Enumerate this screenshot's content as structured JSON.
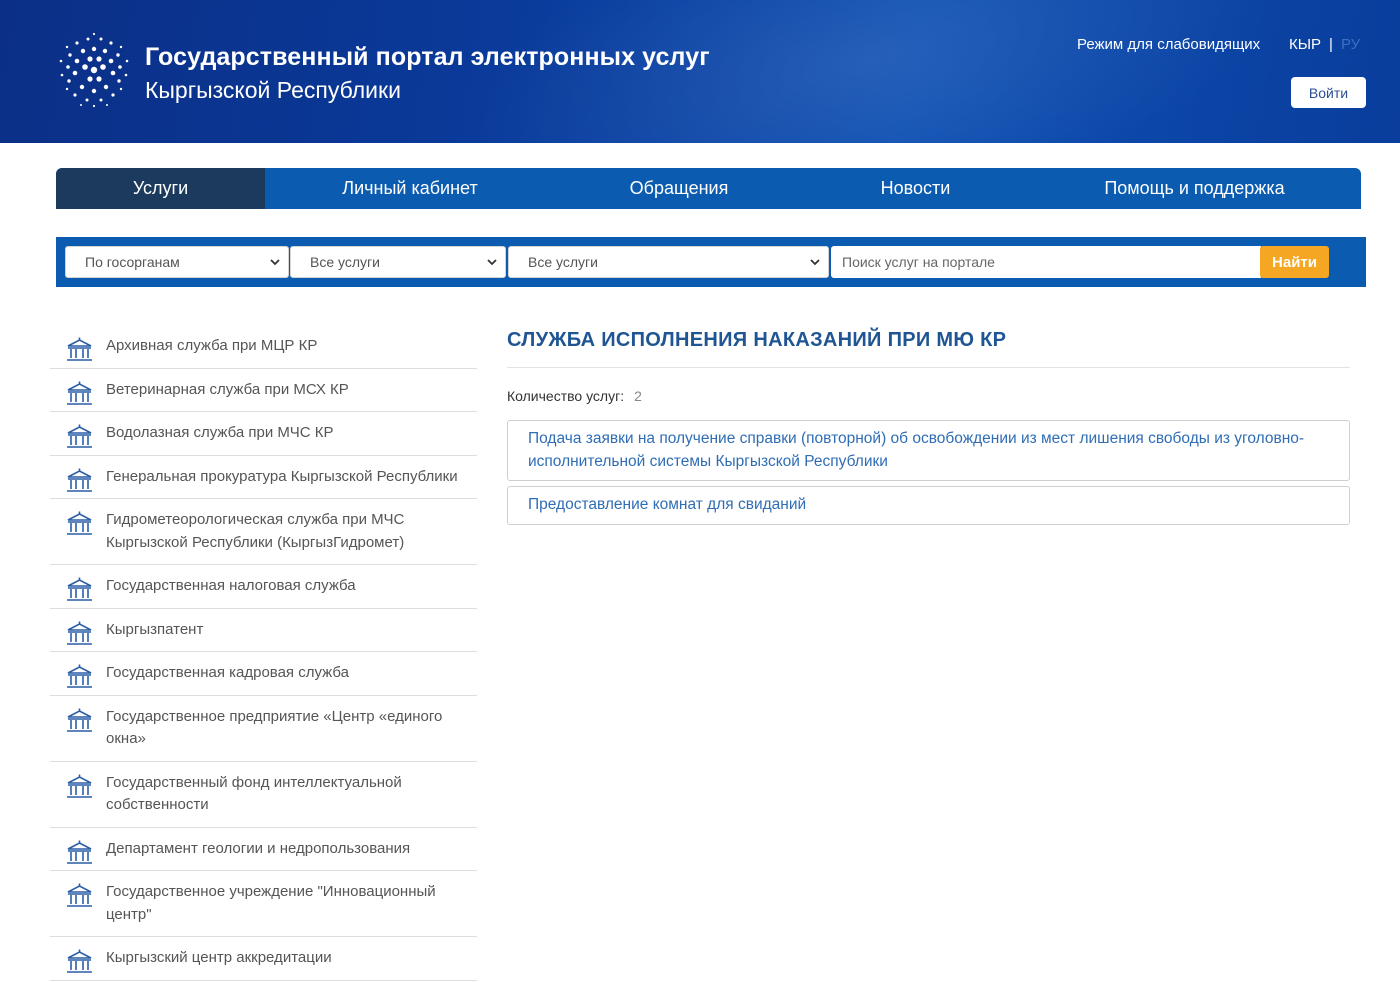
{
  "header": {
    "title_main": "Государственный портал электронных услуг",
    "title_sub": "Кыргызской Республики",
    "accessibility_label": "Режим для слабовидящих",
    "lang_ky": "КЫР",
    "lang_sep": "|",
    "lang_ru": "РУ",
    "login_label": "Войти"
  },
  "nav": {
    "items": [
      {
        "label": "Услуги"
      },
      {
        "label": "Личный кабинет"
      },
      {
        "label": "Обращения"
      },
      {
        "label": "Новости"
      },
      {
        "label": "Помощь и поддержка"
      }
    ]
  },
  "search": {
    "filter_agency": "По госорганам",
    "filter_services_1": "Все услуги",
    "filter_services_2": "Все услуги",
    "placeholder": "Поиск услуг на портале",
    "button_label": "Найти"
  },
  "sidebar": {
    "agencies": [
      "Архивная служба при МЦР КР",
      "Ветеринарная служба при МСХ КР",
      "Водолазная служба при МЧС КР",
      "Генеральная прокуратура Кыргызской Республики",
      "Гидрометеорологическая служба при МЧС Кыргызской Республики (КыргызГидромет)",
      "Государственная налоговая служба",
      "Кыргызпатент",
      "Государственная кадровая служба",
      "Государственное предприятие «Центр «единого окна»",
      "Государственный фонд интеллектуальной собственности",
      "Департамент геологии и недропользования",
      "Государственное учреждение \"Инновационный центр\"",
      "Кыргызский центр аккредитации"
    ]
  },
  "content": {
    "title": "СЛУЖБА ИСПОЛНЕНИЯ НАКАЗАНИЙ ПРИ МЮ КР",
    "count_label": "Количество услуг:",
    "count_value": "2",
    "services": [
      "Подача заявки на получение справки (повторной) об освобождении из мест лишения свободы из уголовно-исполнительной системы Кыргызской Республики",
      "Предоставление комнат для свиданий"
    ]
  },
  "colors": {
    "header_bg": "#0b3a9a",
    "nav_bg": "#0b5bb0",
    "nav_active": "#1b3a5e",
    "accent_button": "#f5a623",
    "link": "#2f6db5",
    "title": "#1f5593"
  },
  "icons": {
    "logo": "portal-logo-icon",
    "agency": "government-building-icon",
    "select": "chevron-down-icon"
  }
}
